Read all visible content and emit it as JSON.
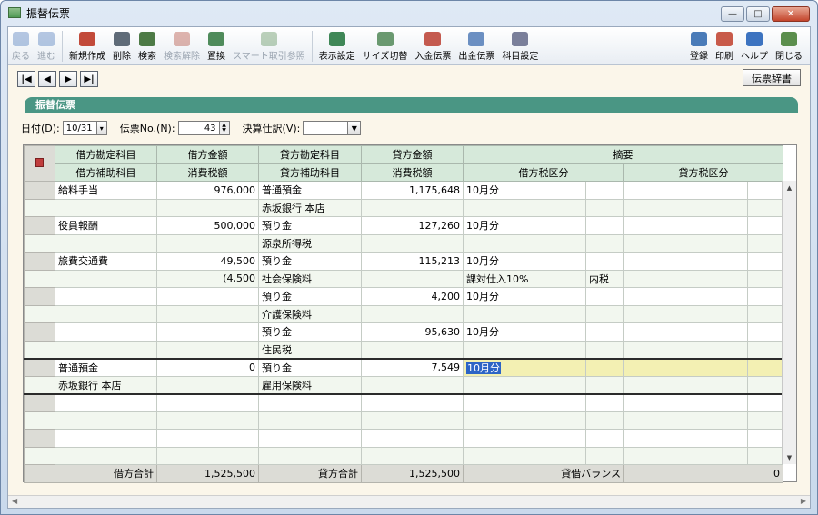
{
  "window": {
    "title": "振替伝票"
  },
  "toolbar": {
    "items": [
      {
        "label": "戻る",
        "icon": "back-arrow-icon",
        "enabled": false
      },
      {
        "label": "進む",
        "icon": "forward-arrow-icon",
        "enabled": false
      },
      {
        "label": "新規作成",
        "icon": "new-document-icon",
        "enabled": true
      },
      {
        "label": "削除",
        "icon": "trash-icon",
        "enabled": true
      },
      {
        "label": "検索",
        "icon": "magnifier-icon",
        "enabled": true
      },
      {
        "label": "検索解除",
        "icon": "clear-search-icon",
        "enabled": false
      },
      {
        "label": "置換",
        "icon": "replace-icon",
        "enabled": true
      },
      {
        "label": "スマート取引参照",
        "icon": "smart-lookup-icon",
        "enabled": false
      },
      {
        "label": "表示設定",
        "icon": "display-settings-icon",
        "enabled": true
      },
      {
        "label": "サイズ切替",
        "icon": "resize-icon",
        "enabled": true
      },
      {
        "label": "入金伝票",
        "icon": "deposit-slip-icon",
        "enabled": true
      },
      {
        "label": "出金伝票",
        "icon": "withdrawal-slip-icon",
        "enabled": true
      },
      {
        "label": "科目設定",
        "icon": "account-settings-icon",
        "enabled": true
      }
    ],
    "right_items": [
      {
        "label": "登録",
        "icon": "register-icon"
      },
      {
        "label": "印刷",
        "icon": "printer-icon"
      },
      {
        "label": "ヘルプ",
        "icon": "help-icon"
      },
      {
        "label": "閉じる",
        "icon": "close-door-icon"
      }
    ]
  },
  "nav": {
    "first": "|◀",
    "prev": "◀",
    "next": "▶",
    "last": "▶|"
  },
  "dict_button": "伝票辞書",
  "section_title": "振替伝票",
  "fields": {
    "date_label": "日付(D):",
    "date_value": "10/31",
    "slip_no_label": "伝票No.(N):",
    "slip_no_value": "43",
    "closing_label": "決算仕訳(V):",
    "closing_value": ""
  },
  "grid": {
    "header1": [
      "借方勘定科目",
      "借方金額",
      "貸方勘定科目",
      "貸方金額",
      "摘要"
    ],
    "header2": [
      "借方補助科目",
      "消費税額",
      "貸方補助科目",
      "消費税額",
      "借方税区分",
      "貸方税区分"
    ],
    "entries": [
      {
        "row1": [
          "給料手当",
          "976,000",
          "普通預金",
          "1,175,648",
          "10月分",
          "",
          "",
          ""
        ],
        "row2": [
          "",
          "",
          "赤坂銀行 本店",
          "",
          "",
          "",
          "",
          ""
        ]
      },
      {
        "row1": [
          "役員報酬",
          "500,000",
          "預り金",
          "127,260",
          "10月分",
          "",
          "",
          ""
        ],
        "row2": [
          "",
          "",
          "源泉所得税",
          "",
          "",
          "",
          "",
          ""
        ]
      },
      {
        "row1": [
          "旅費交通費",
          "49,500",
          "預り金",
          "115,213",
          "10月分",
          "",
          "",
          ""
        ],
        "row2": [
          "",
          "(4,500",
          "社会保険料",
          "",
          "課対仕入10%",
          "内税",
          "",
          ""
        ]
      },
      {
        "row1": [
          "",
          "",
          "預り金",
          "4,200",
          "10月分",
          "",
          "",
          ""
        ],
        "row2": [
          "",
          "",
          "介護保険料",
          "",
          "",
          "",
          "",
          ""
        ]
      },
      {
        "row1": [
          "",
          "",
          "預り金",
          "95,630",
          "10月分",
          "",
          "",
          ""
        ],
        "row2": [
          "",
          "",
          "住民税",
          "",
          "",
          "",
          "",
          ""
        ]
      },
      {
        "row1": [
          "普通預金",
          "0",
          "預り金",
          "7,549",
          "10月分",
          "",
          "",
          ""
        ],
        "row2": [
          "赤坂銀行 本店",
          "",
          "雇用保険料",
          "",
          "",
          "",
          "",
          ""
        ]
      }
    ],
    "totals": {
      "debit_label": "借方合計",
      "debit_value": "1,525,500",
      "credit_label": "貸方合計",
      "credit_value": "1,525,500",
      "balance_label": "貸借バランス",
      "balance_value": "0"
    }
  },
  "colors": {
    "section_bar": "#4a9684",
    "header_bg": "#d6e9da",
    "selected_cell": "#f3f0b3",
    "window_bg": "#fbf6ea"
  }
}
